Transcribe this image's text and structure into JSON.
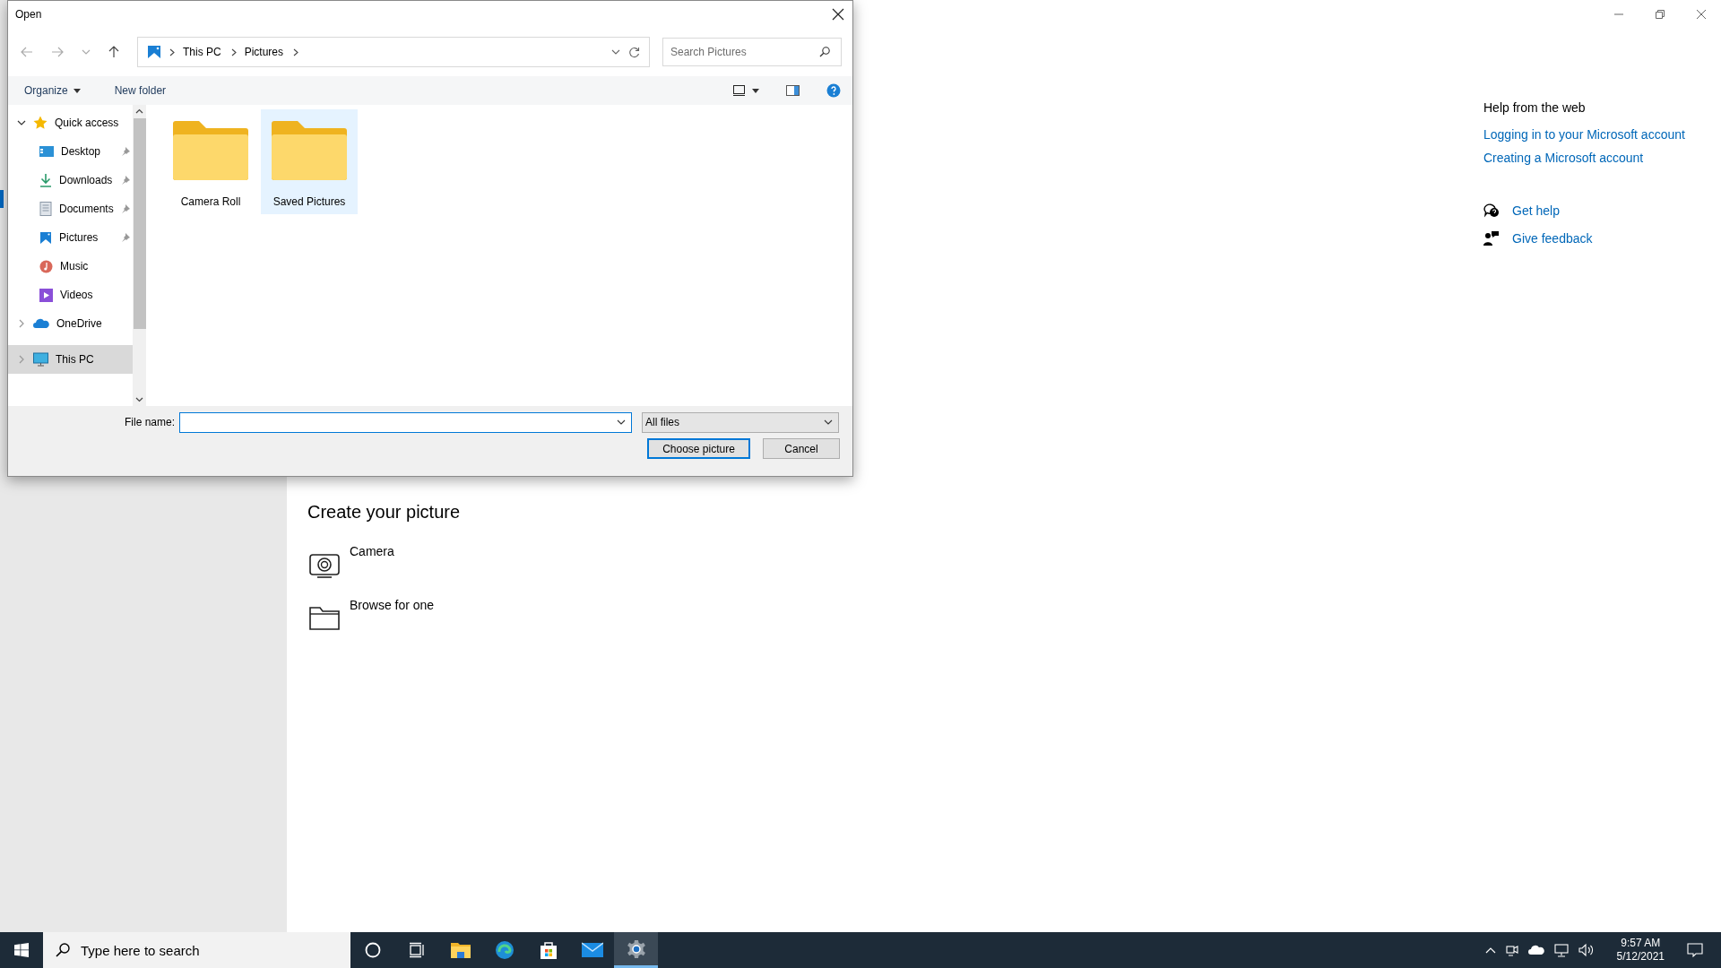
{
  "settings_window": {
    "section_title": "Create your picture",
    "options": [
      "Camera",
      "Browse for one"
    ],
    "help": {
      "title": "Help from the web",
      "links": [
        "Logging in to your Microsoft account",
        "Creating a Microsoft account"
      ],
      "actions": [
        "Get help",
        "Give feedback"
      ]
    }
  },
  "dialog": {
    "title": "Open",
    "breadcrumb": [
      "This PC",
      "Pictures"
    ],
    "search": {
      "placeholder": "Search Pictures"
    },
    "toolbar": [
      "Organize",
      "New folder"
    ],
    "nav": [
      {
        "label": "Quick access",
        "expanded": true,
        "selected": false,
        "children": [
          {
            "label": "Desktop",
            "pinned": true
          },
          {
            "label": "Downloads",
            "pinned": true
          },
          {
            "label": "Documents",
            "pinned": true
          },
          {
            "label": "Pictures",
            "pinned": true
          },
          {
            "label": "Music",
            "pinned": false
          },
          {
            "label": "Videos",
            "pinned": false
          }
        ]
      },
      {
        "label": "OneDrive",
        "expanded": false,
        "selected": false
      },
      {
        "label": "This PC",
        "expanded": false,
        "selected": true
      }
    ],
    "folders": [
      {
        "label": "Camera Roll",
        "selected": false
      },
      {
        "label": "Saved Pictures",
        "selected": true
      }
    ],
    "file_name_label": "File name:",
    "file_type": "All files",
    "buttons": [
      {
        "label": "Choose picture",
        "default": true
      },
      {
        "label": "Cancel",
        "default": false
      }
    ]
  },
  "taskbar": {
    "search_placeholder": "Type here to search",
    "apps": [
      {
        "active": false
      },
      {
        "active": false
      },
      {
        "active": false
      },
      {
        "active": false
      },
      {
        "active": false
      },
      {
        "active": false
      },
      {
        "active": true
      }
    ],
    "clock": {
      "time": "9:57 AM",
      "date": "5/12/2021"
    }
  }
}
